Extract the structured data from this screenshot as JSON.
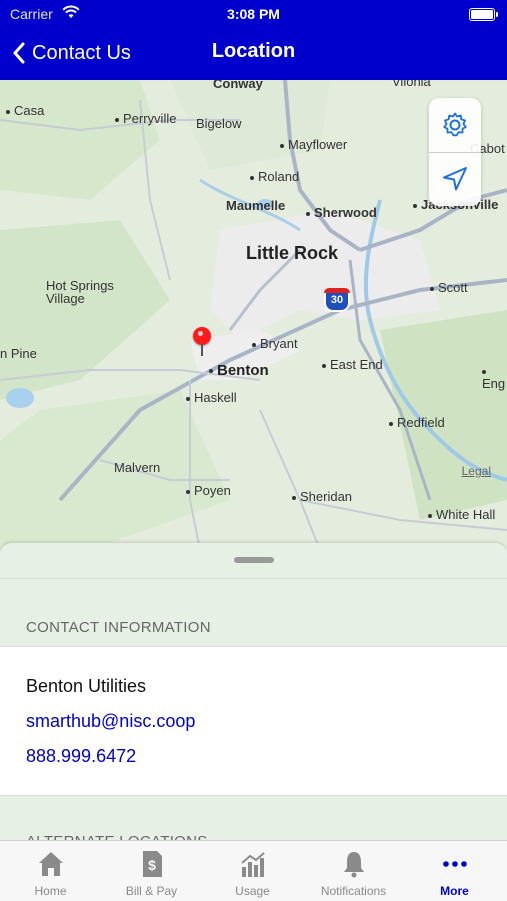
{
  "status_bar": {
    "carrier": "Carrier",
    "time": "3:08 PM"
  },
  "nav": {
    "back_label": "Contact Us",
    "title": "Location"
  },
  "map": {
    "labels": {
      "conway": "Conway",
      "vilonia": "Vilonia",
      "casa": "Casa",
      "perryville": "Perryville",
      "bigelow": "Bigelow",
      "mayflower": "Mayflower",
      "cabot": "Cabot",
      "roland": "Roland",
      "maumelle": "Maumelle",
      "sherwood": "Sherwood",
      "jacksonville": "Jacksonville",
      "little_rock": "Little Rock",
      "hot_springs_village": "Hot Springs\nVillage",
      "scott": "Scott",
      "pine": "n Pine",
      "bryant": "Bryant",
      "benton": "Benton",
      "east_end": "East End",
      "england": "Eng",
      "haskell": "Haskell",
      "redfield": "Redfield",
      "malvern": "Malvern",
      "poyen": "Poyen",
      "sheridan": "Sheridan",
      "white_hall": "White Hall",
      "interstate": "30"
    },
    "legal": "Legal",
    "tools": {
      "settings_icon": "gear-icon",
      "location_icon": "location-arrow-icon"
    }
  },
  "sheet": {
    "contact_header": "CONTACT INFORMATION",
    "contact": {
      "name": "Benton Utilities",
      "email": "smarthub@nisc.coop",
      "phone": "888.999.6472"
    },
    "alternate_header": "ALTERNATE LOCATIONS"
  },
  "tabbar": {
    "tabs": [
      {
        "label": "Home",
        "icon": "home-icon"
      },
      {
        "label": "Bill & Pay",
        "icon": "bill-icon"
      },
      {
        "label": "Usage",
        "icon": "usage-chart-icon"
      },
      {
        "label": "Notifications",
        "icon": "bell-icon"
      },
      {
        "label": "More",
        "icon": "more-dots-icon"
      }
    ],
    "active_index": 4
  },
  "colors": {
    "brand": "#0000cc",
    "pin": "#ff1a1a",
    "tab_inactive": "#8a8a8a"
  }
}
